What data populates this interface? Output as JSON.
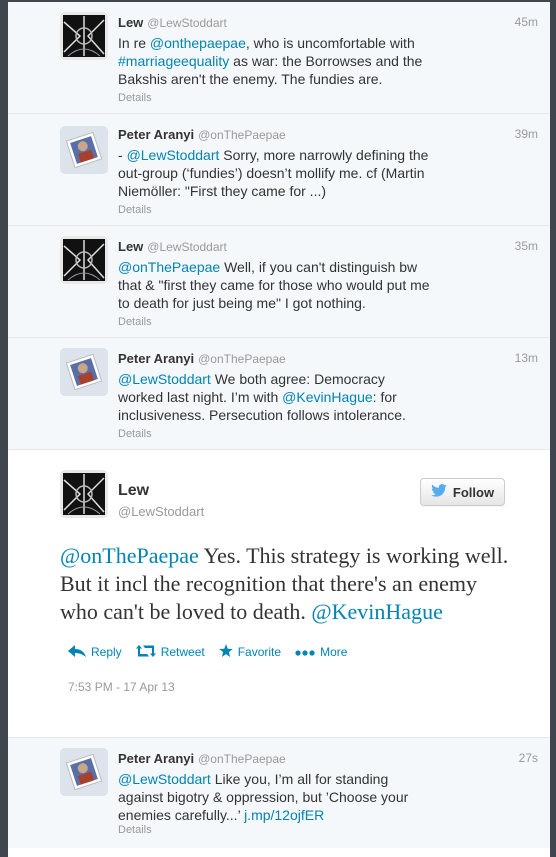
{
  "colors": {
    "link": "#0084b4",
    "muted": "#999999",
    "background": "#3f464e"
  },
  "tweets_before": [
    {
      "author": "Lew",
      "handle": "@LewStoddart",
      "time": "45m",
      "avatar": "lew-avatar",
      "parts": [
        {
          "t": "In re "
        },
        {
          "t": "@onthepaepae",
          "link": true
        },
        {
          "t": ", who is uncomfortable with "
        },
        {
          "t": "#marriageequality",
          "link": true
        },
        {
          "t": " as war: the Borrowses and the Bakshis aren't the enemy. The fundies are."
        }
      ],
      "details": "Details"
    },
    {
      "author": "Peter Aranyi",
      "handle": "@onThePaepae",
      "time": "39m",
      "avatar": "peter-avatar",
      "parts": [
        {
          "t": "- "
        },
        {
          "t": "@LewStoddart",
          "link": true
        },
        {
          "t": " Sorry, more narrowly defining the out-group  (‘fundies’) doesn’t mollify me. cf (Martin Niemöller: \"First they came for ...)"
        }
      ],
      "details": "Details"
    },
    {
      "author": "Lew",
      "handle": "@LewStoddart",
      "time": "35m",
      "avatar": "lew-avatar",
      "parts": [
        {
          "t": "@onThePaepae",
          "link": true
        },
        {
          "t": " Well, if you can't distinguish bw that & \"first they came for those who would put me to death for just being me\" I got nothing."
        }
      ],
      "details": "Details"
    },
    {
      "author": "Peter Aranyi",
      "handle": "@onThePaepae",
      "time": "13m",
      "avatar": "peter-avatar",
      "parts": [
        {
          "t": "@LewStoddart",
          "link": true
        },
        {
          "t": " We both agree: Democracy worked last night. I’m with "
        },
        {
          "t": "@KevinHague",
          "link": true
        },
        {
          "t": ": for inclusiveness. Persecution follows intolerance."
        }
      ],
      "details": "Details"
    }
  ],
  "expanded": {
    "author": "Lew",
    "handle": "@LewStoddart",
    "follow_label": "Follow",
    "parts": [
      {
        "t": "@onThePaepae",
        "link": true
      },
      {
        "t": " Yes. This strategy is working well. But it incl the recognition that there's an enemy who can't be loved to death. "
      },
      {
        "t": "@KevinHague",
        "link": true
      }
    ],
    "actions": {
      "reply": "Reply",
      "retweet": "Retweet",
      "favorite": "Favorite",
      "more": "More"
    },
    "date": "7:53 PM - 17 Apr 13"
  },
  "tweet_after": {
    "author": "Peter Aranyi",
    "handle": "@onThePaepae",
    "time": "27s",
    "avatar": "peter-avatar",
    "parts": [
      {
        "t": "@LewStoddart",
        "link": true
      },
      {
        "t": " Like you, I’m all for standing against bigotry & oppression, but ’Choose your enemies carefully...’ "
      },
      {
        "t": "j.mp/12ojfER",
        "link": true
      }
    ],
    "details": "Details"
  }
}
